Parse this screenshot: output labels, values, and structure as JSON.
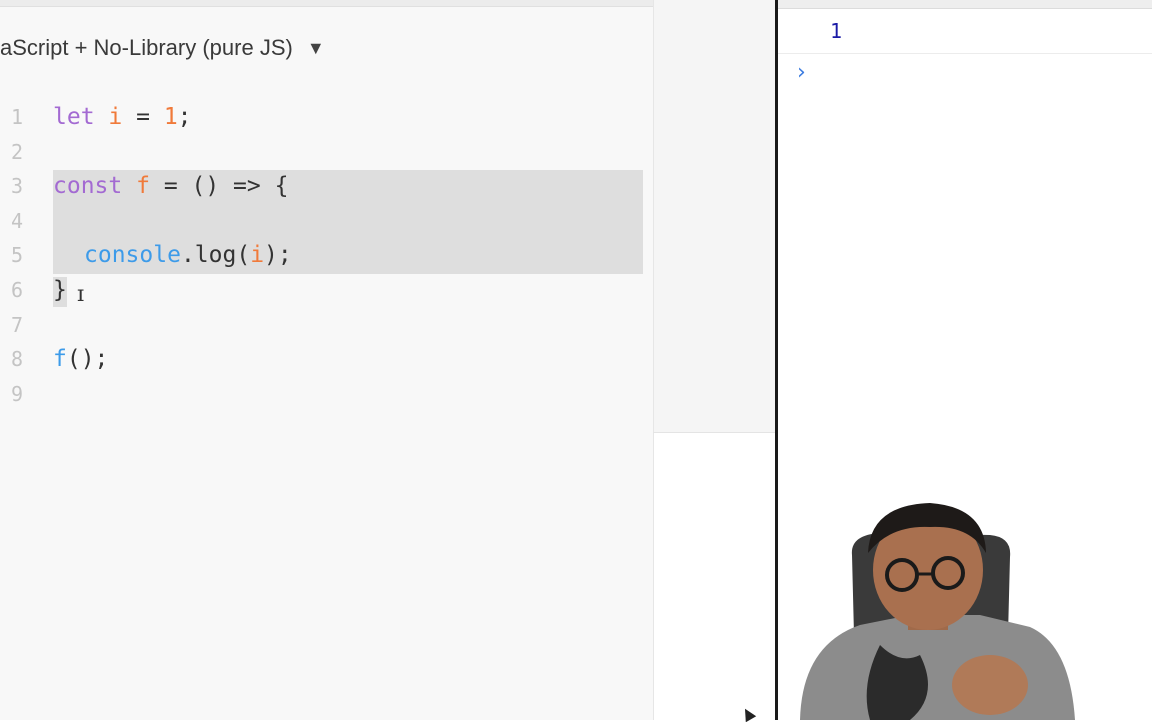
{
  "editor": {
    "language_label": "aScript + No-Library (pure JS)",
    "language_arrow": "▼",
    "lines": [
      {
        "n": "1"
      },
      {
        "n": "2"
      },
      {
        "n": "3"
      },
      {
        "n": "4"
      },
      {
        "n": "5"
      },
      {
        "n": "6"
      },
      {
        "n": "7"
      },
      {
        "n": "8"
      },
      {
        "n": "9"
      }
    ],
    "code": {
      "l1": {
        "kw": "let",
        "id": "i",
        "op": " = ",
        "num": "1",
        "end": ";"
      },
      "l3": {
        "kw": "const",
        "id": "f",
        "rest": " = () => {"
      },
      "l5": {
        "obj": "console",
        "rest": ".log(",
        "id": "i",
        "end": ");"
      },
      "l6": {
        "text": "}"
      },
      "l8": {
        "fn": "f",
        "rest": "();"
      }
    }
  },
  "console": {
    "output": "1",
    "prompt": "›"
  },
  "colors": {
    "keyword": "#a36ad2",
    "identifier": "#f07a3a",
    "function": "#3d9be9",
    "console_output": "#1a1aa6",
    "prompt": "#3c7ce0"
  }
}
